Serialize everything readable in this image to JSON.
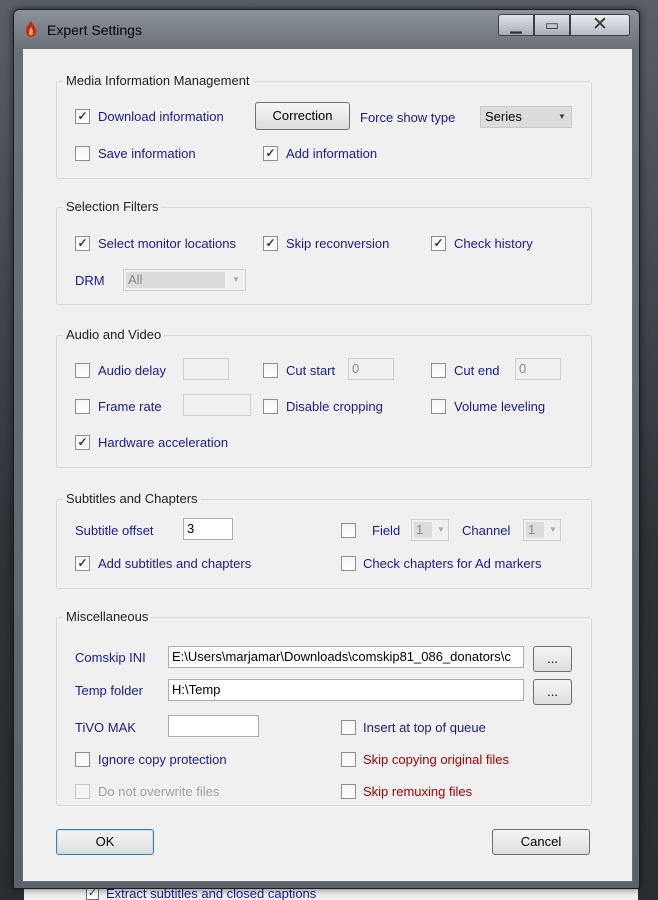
{
  "window": {
    "title": "Expert Settings"
  },
  "background": {
    "behind_label": "Extract subtitles and closed captions"
  },
  "media_info": {
    "title": "Media Information Management",
    "download_information": "Download information",
    "correction_button": "Correction",
    "force_show_type_label": "Force show type",
    "force_show_type_value": "Series",
    "save_information": "Save information",
    "add_information": "Add information"
  },
  "selection_filters": {
    "title": "Selection Filters",
    "select_monitor_locations": "Select monitor locations",
    "skip_reconversion": "Skip reconversion",
    "check_history": "Check history",
    "drm_label": "DRM",
    "drm_value": "All"
  },
  "audio_video": {
    "title": "Audio and Video",
    "audio_delay": "Audio delay",
    "cut_start": "Cut start",
    "cut_start_value": "0",
    "cut_end": "Cut end",
    "cut_end_value": "0",
    "frame_rate": "Frame rate",
    "disable_cropping": "Disable cropping",
    "volume_leveling": "Volume leveling",
    "hardware_acceleration": "Hardware acceleration"
  },
  "subtitles": {
    "title": "Subtitles and Chapters",
    "subtitle_offset_label": "Subtitle offset",
    "subtitle_offset_value": "3",
    "field_label": "Field",
    "field_value": "1",
    "channel_label": "Channel",
    "channel_value": "1",
    "add_subtitles_and_chapters": "Add subtitles and chapters",
    "check_chapters_for_ad_markers": "Check chapters for Ad markers"
  },
  "misc": {
    "title": "Miscellaneous",
    "comskip_ini_label": "Comskip INI",
    "comskip_ini_value": "E:\\Users\\marjamar\\Downloads\\comskip81_086_donators\\c",
    "browse_label": "...",
    "temp_folder_label": "Temp folder",
    "temp_folder_value": "H:\\Temp",
    "tivo_mak_label": "TiVO MAK",
    "insert_at_top_of_queue": "Insert at top of queue",
    "ignore_copy_protection": "Ignore copy protection",
    "skip_copying_original_files": "Skip copying original files",
    "do_not_overwrite_files": "Do not overwrite files",
    "skip_remuxing_files": "Skip remuxing files"
  },
  "buttons": {
    "ok": "OK",
    "cancel": "Cancel"
  },
  "check_glyph": "✓",
  "colors": {
    "label_blue": "#1a1a9a",
    "label_red": "#b00000"
  }
}
